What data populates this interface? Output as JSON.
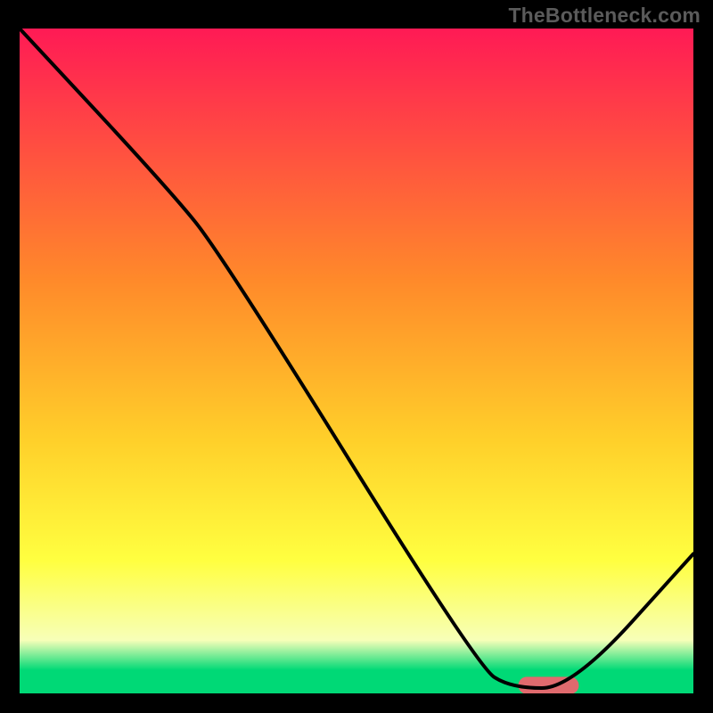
{
  "watermark": "TheBottleneck.com",
  "chart_data": {
    "type": "line",
    "title": "",
    "xlabel": "",
    "ylabel": "",
    "xlim": [
      0,
      100
    ],
    "ylim": [
      0,
      100
    ],
    "gradient_colors": {
      "top": "#ff1a55",
      "mid1": "#ff8a2a",
      "mid2": "#ffd02a",
      "mid3": "#ffff40",
      "low": "#f7ffb8",
      "bottom": "#00d976"
    },
    "series": [
      {
        "name": "curve",
        "type": "line",
        "points": [
          {
            "x": 0,
            "y": 100
          },
          {
            "x": 22,
            "y": 76
          },
          {
            "x": 30,
            "y": 66
          },
          {
            "x": 68,
            "y": 4
          },
          {
            "x": 73,
            "y": 0.8
          },
          {
            "x": 82,
            "y": 0.8
          },
          {
            "x": 100,
            "y": 21
          }
        ]
      },
      {
        "name": "marker",
        "type": "marker",
        "shape": "rounded-rect",
        "color": "#e06a6e",
        "x_range": [
          74,
          83
        ],
        "y": 1.2,
        "height_pct": 2.6
      }
    ],
    "notes": "y-values in percent of plot height from bottom; curve is a bottleneck-style V with an initial steeper segment then near-linear descent to ~0 around x≈73–82, then rise to ~21% at x=100."
  }
}
